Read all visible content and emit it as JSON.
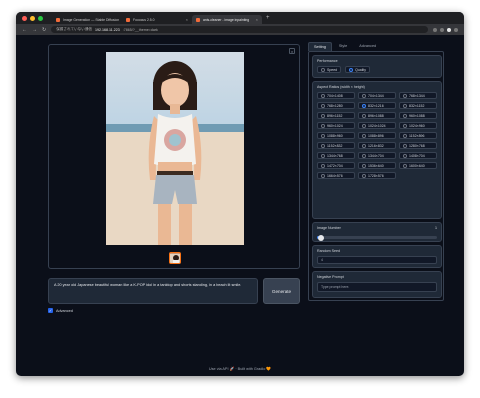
{
  "browser": {
    "tabs": [
      {
        "title": "Image Generation — Stable Diffusion",
        "active": false
      },
      {
        "title": "Fooocus 2.5.0",
        "active": false
      },
      {
        "title": "anis-cleaner - image inpainting",
        "active": true
      }
    ],
    "url_prefix": "保護されていない通信",
    "url_host": "192.168.11.223",
    "url_path": ":7865/?__theme=dark"
  },
  "main": {
    "prompt_text": "A 20 year old Japanese beautiful woman like a K-POP idol in a tanktop and shorts standing, in a beach lit smile.",
    "generate_label": "Generate",
    "advanced_label": "Advanced",
    "close_glyph": "×"
  },
  "settings": {
    "tabs": [
      "Setting",
      "Style",
      "Advanced"
    ],
    "performance": {
      "label": "Performance",
      "options": [
        "Speed",
        "Quality"
      ],
      "selected": "Quality"
    },
    "aspect": {
      "label": "Aspect Ratios (width × height)",
      "options": [
        "704×1408",
        "704×1344",
        "768×1344",
        "768×1280",
        "832×1216",
        "832×1152",
        "896×1152",
        "896×1088",
        "960×1088",
        "960×1024",
        "1024×1024",
        "1024×960",
        "1088×960",
        "1088×896",
        "1152×896",
        "1152×832",
        "1216×832",
        "1280×768",
        "1344×768",
        "1344×704",
        "1408×704",
        "1472×704",
        "1536×640",
        "1600×640",
        "1664×576",
        "1728×576"
      ],
      "selected": "832×1216"
    },
    "image_number": {
      "label": "Image Number",
      "value": "1",
      "fraction": 0.03
    },
    "random_seed": {
      "label": "Random Seed",
      "value": "4"
    },
    "negative_prompt": {
      "label": "Negative Prompt",
      "placeholder": "Type prompt here."
    }
  },
  "footer": "Use via API 🚀 · Built with Gradio 🧡"
}
